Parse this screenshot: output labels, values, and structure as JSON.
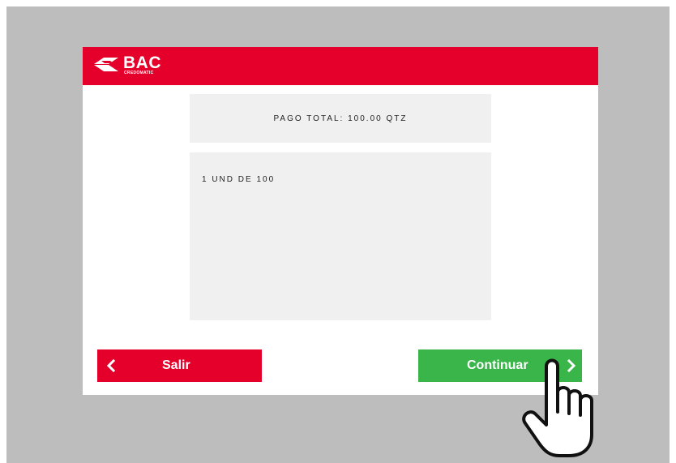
{
  "header": {
    "brand": "BAC",
    "brand_sub": "CREDOMATIC",
    "logo_icon": "bac-logo-icon",
    "color": "#e5002b"
  },
  "summary": {
    "total_text": "PAGO TOTAL: 100.00 QTZ"
  },
  "detail": {
    "lines": [
      "1 UND DE 100"
    ]
  },
  "buttons": {
    "exit_label": "Salir",
    "exit_icon": "chevron-left-icon",
    "exit_color": "#e5002b",
    "continue_label": "Continuar",
    "continue_icon": "chevron-right-icon",
    "continue_color": "#39b54a"
  },
  "cursor": {
    "icon": "hand-pointer-icon"
  }
}
